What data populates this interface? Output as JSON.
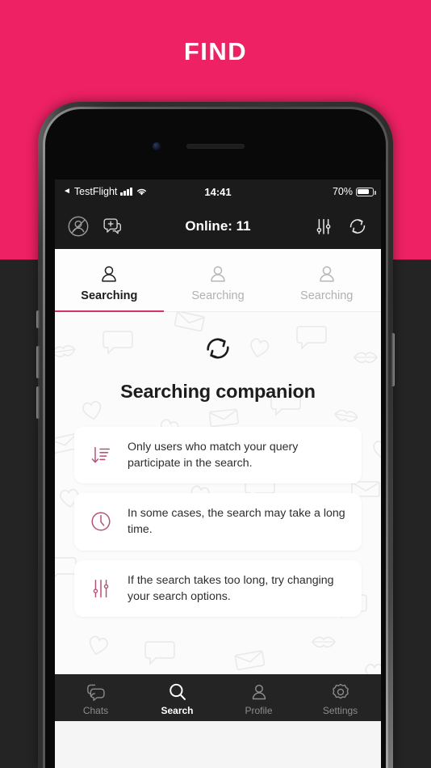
{
  "promo": {
    "title": "FIND",
    "background_color": "#ED2164",
    "lower_background_color": "#242424"
  },
  "theme": {
    "accent_pink": "#d3326a",
    "icon_pink": "#b5517a",
    "dark_chrome": "#1b1b1b",
    "nav_dark": "#242424"
  },
  "status_bar": {
    "carrier": "TestFlight",
    "back_arrow": "back-arrow-icon",
    "signal": "cellular-signal-icon",
    "wifi": "wifi-icon",
    "time": "14:41",
    "battery_percent": "70%",
    "battery": "battery-icon"
  },
  "app_header": {
    "left_icons": [
      {
        "name": "blocked-users-icon",
        "label": "Blocked users"
      },
      {
        "name": "new-chat-icon",
        "label": "New chat"
      }
    ],
    "title": "Online: 11",
    "right_icons": [
      {
        "name": "filter-sliders-icon",
        "label": "Search filters"
      },
      {
        "name": "refresh-icon",
        "label": "Refresh"
      }
    ]
  },
  "tabs": [
    {
      "label": "Searching",
      "icon": "person-icon",
      "active": true
    },
    {
      "label": "Searching",
      "icon": "person-icon",
      "active": false
    },
    {
      "label": "Searching",
      "icon": "person-icon",
      "active": false
    }
  ],
  "hero": {
    "icon": "refresh-sync-icon",
    "title": "Searching companion"
  },
  "cards": [
    {
      "icon": "sort-descending-icon",
      "text": "Only users who match your query participate in the search."
    },
    {
      "icon": "clock-icon",
      "text": "In some cases, the search may take a long time."
    },
    {
      "icon": "sliders-icon",
      "text": "If the search takes too long, try changing your search options."
    }
  ],
  "bottom_nav": [
    {
      "label": "Chats",
      "icon": "chats-icon",
      "active": false
    },
    {
      "label": "Search",
      "icon": "search-icon",
      "active": true
    },
    {
      "label": "Profile",
      "icon": "profile-icon",
      "active": false
    },
    {
      "label": "Settings",
      "icon": "settings-gear-icon",
      "active": false
    }
  ]
}
